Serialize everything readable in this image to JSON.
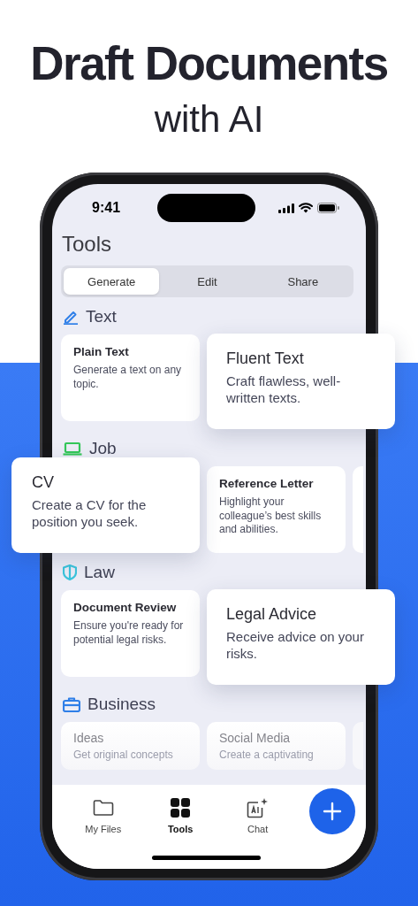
{
  "headline": {
    "title": "Draft Documents",
    "subtitle": "with AI"
  },
  "status_bar": {
    "time": "9:41"
  },
  "screen_title": "Tools",
  "tabs": [
    {
      "label": "Generate",
      "selected": true
    },
    {
      "label": "Edit",
      "selected": false
    },
    {
      "label": "Share",
      "selected": false
    }
  ],
  "sections": [
    {
      "title": "Text",
      "kind": "pencil",
      "color": "#2f7fe8",
      "cards": [
        {
          "title": "Plain Text",
          "description": "Generate a text on any topic.",
          "highlighted": false
        },
        {
          "title": "Fluent Text",
          "description": "Craft flawless, well-written texts.",
          "highlighted": true
        }
      ]
    },
    {
      "title": "Job",
      "kind": "laptop",
      "color": "#34c759",
      "cards": [
        {
          "title": "CV",
          "description": "Create a CV for the position you seek.",
          "highlighted": true
        },
        {
          "title": "Reference Letter",
          "description": "Highlight your colleague’s best skills and abilities.",
          "highlighted": false
        }
      ]
    },
    {
      "title": "Law",
      "kind": "shield",
      "color": "#3bc4dc",
      "cards": [
        {
          "title": "Document Review",
          "description": "Ensure you're ready for potential legal risks.",
          "highlighted": false
        },
        {
          "title": "Legal Advice",
          "description": "Receive advice on your risks.",
          "highlighted": true
        }
      ]
    },
    {
      "title": "Business",
      "kind": "briefcase",
      "color": "#2f7fe8",
      "cards": [
        {
          "title": "Ideas",
          "description": "Get original concepts",
          "highlighted": false
        },
        {
          "title": "Social Media",
          "description": "Create a captivating",
          "highlighted": false
        }
      ]
    }
  ],
  "tab_bar": {
    "items": [
      {
        "label": "My Files",
        "kind": "folder",
        "selected": false
      },
      {
        "label": "Tools",
        "kind": "grid",
        "selected": true
      },
      {
        "label": "Chat",
        "kind": "chat",
        "selected": false
      }
    ]
  }
}
